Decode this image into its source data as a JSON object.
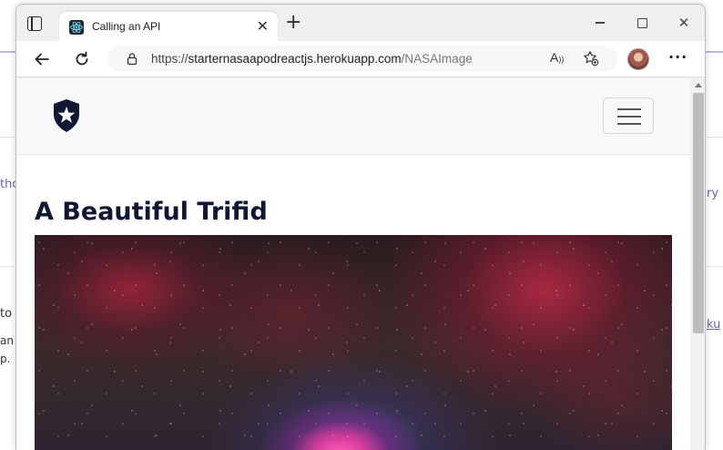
{
  "background": {
    "fragments": [
      {
        "id": "bg-text-1",
        "text": "tho"
      },
      {
        "id": "bg-text-2",
        "text": "ry"
      },
      {
        "id": "bg-text-3",
        "text": "to C"
      },
      {
        "id": "bg-text-4",
        "text": "an"
      },
      {
        "id": "bg-text-5",
        "text": "p."
      },
      {
        "id": "bg-text-6",
        "text": "ku"
      }
    ]
  },
  "browser": {
    "tab": {
      "title": "Calling an API",
      "favicon": "react-logo-icon"
    },
    "url": {
      "protocol": "https://",
      "host": "starternasaapodreactjs.herokuapp.com",
      "path": "/NASAImage"
    },
    "icons": {
      "tab_actions": "tab-actions-icon",
      "new_tab": "plus-icon",
      "back": "back-arrow-icon",
      "refresh": "refresh-icon",
      "lock": "lock-icon",
      "read_aloud": "read-aloud-icon",
      "favorites": "add-favorite-icon",
      "more": "more-icon"
    }
  },
  "page": {
    "brand": "auth0-shield-star-logo",
    "title": "A Beautiful Trifid",
    "image_alt": "nebula-photo"
  },
  "colors": {
    "title": "#0f1733",
    "navbar_bg": "#f7f8fa",
    "background_link": "#6b5fb0"
  }
}
